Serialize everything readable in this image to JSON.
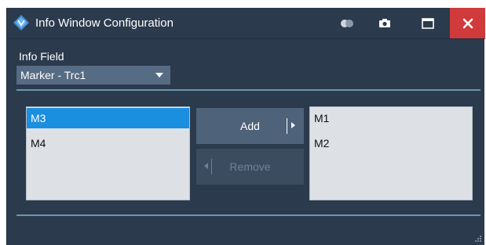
{
  "window": {
    "title": "Info Window Configuration",
    "icons": {
      "logo": "rohde-schwarz-logo-icon",
      "toggle": "toggle-icon",
      "screenshot": "camera-icon",
      "maximize": "maximize-icon",
      "close": "close-icon"
    },
    "colors": {
      "background": "#2b3a4c",
      "close": "#d03a3a",
      "selection": "#1a8fe0"
    }
  },
  "info_field": {
    "label": "Info Field",
    "selected": "Marker - Trc1"
  },
  "available_list": {
    "items": [
      "M3",
      "M4"
    ],
    "selected_index": 0
  },
  "add_button": {
    "label": "Add"
  },
  "remove_button": {
    "label": "Remove",
    "enabled": false
  },
  "chosen_list": {
    "items": [
      "M1",
      "M2"
    ]
  }
}
